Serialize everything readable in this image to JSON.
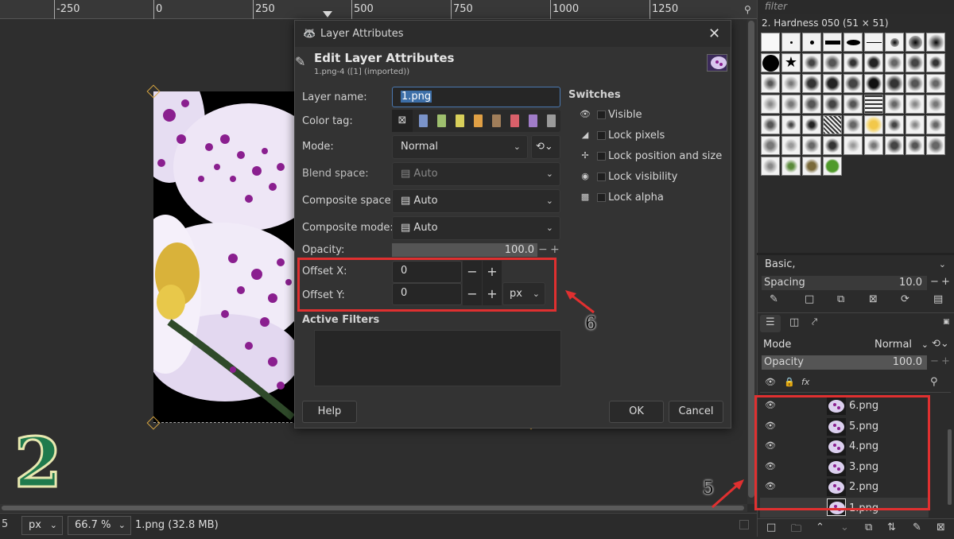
{
  "ruler": {
    "ticks": [
      "-250",
      "0",
      "250",
      "500",
      "750",
      "1000",
      "1250"
    ]
  },
  "canvas": {
    "step_number": "2"
  },
  "status": {
    "unit": "px",
    "zoom": "66.7 %",
    "info": "1.png (32.8 MB)",
    "left_value": "5"
  },
  "dialog": {
    "window_title": "Layer Attributes",
    "heading": "Edit Layer Attributes",
    "subheading": "1.png-4 ([1] (imported))",
    "layer_name_label": "Layer name:",
    "layer_name_value": "1.png",
    "color_tag_label": "Color tag:",
    "color_tag_none": "⊠",
    "color_tags": [
      "#7a93c9",
      "#9ebf6e",
      "#d8cf5a",
      "#e0a045",
      "#a07e5a",
      "#d9606a",
      "#a07cc8",
      "#9a9a9a"
    ],
    "mode_label": "Mode:",
    "mode_value": "Normal",
    "blend_space_label": "Blend space:",
    "blend_space_value": "Auto",
    "composite_space_label": "Composite space:",
    "composite_space_value": "Auto",
    "composite_mode_label": "Composite mode:",
    "composite_mode_value": "Auto",
    "opacity_label": "Opacity:",
    "opacity_value": "100.0",
    "offset_x_label": "Offset X:",
    "offset_x_value": "0",
    "offset_y_label": "Offset Y:",
    "offset_y_value": "0",
    "unit_value": "px",
    "active_filters_label": "Active Filters",
    "switches_label": "Switches",
    "switches": [
      "Visible",
      "Lock pixels",
      "Lock position and size",
      "Lock visibility",
      "Lock alpha"
    ],
    "help_button": "Help",
    "ok_button": "OK",
    "cancel_button": "Cancel",
    "minus": "−",
    "plus": "+"
  },
  "annotations": {
    "arrow_6_label": "6",
    "arrow_5_label": "5"
  },
  "brushes": {
    "filter_placeholder": "filter",
    "title": "2. Hardness 050 (51 × 51)",
    "preset": "Basic,",
    "spacing_label": "Spacing",
    "spacing_value": "10.0"
  },
  "layers": {
    "mode_label": "Mode",
    "mode_value": "Normal",
    "opacity_label": "Opacity",
    "opacity_value": "100.0",
    "items": [
      "6.png",
      "5.png",
      "4.png",
      "3.png",
      "2.png",
      "1.png"
    ]
  },
  "colors": {
    "accent_red": "#e03030",
    "dialog_bg": "#333333",
    "highlight": "#2f5f9a"
  }
}
